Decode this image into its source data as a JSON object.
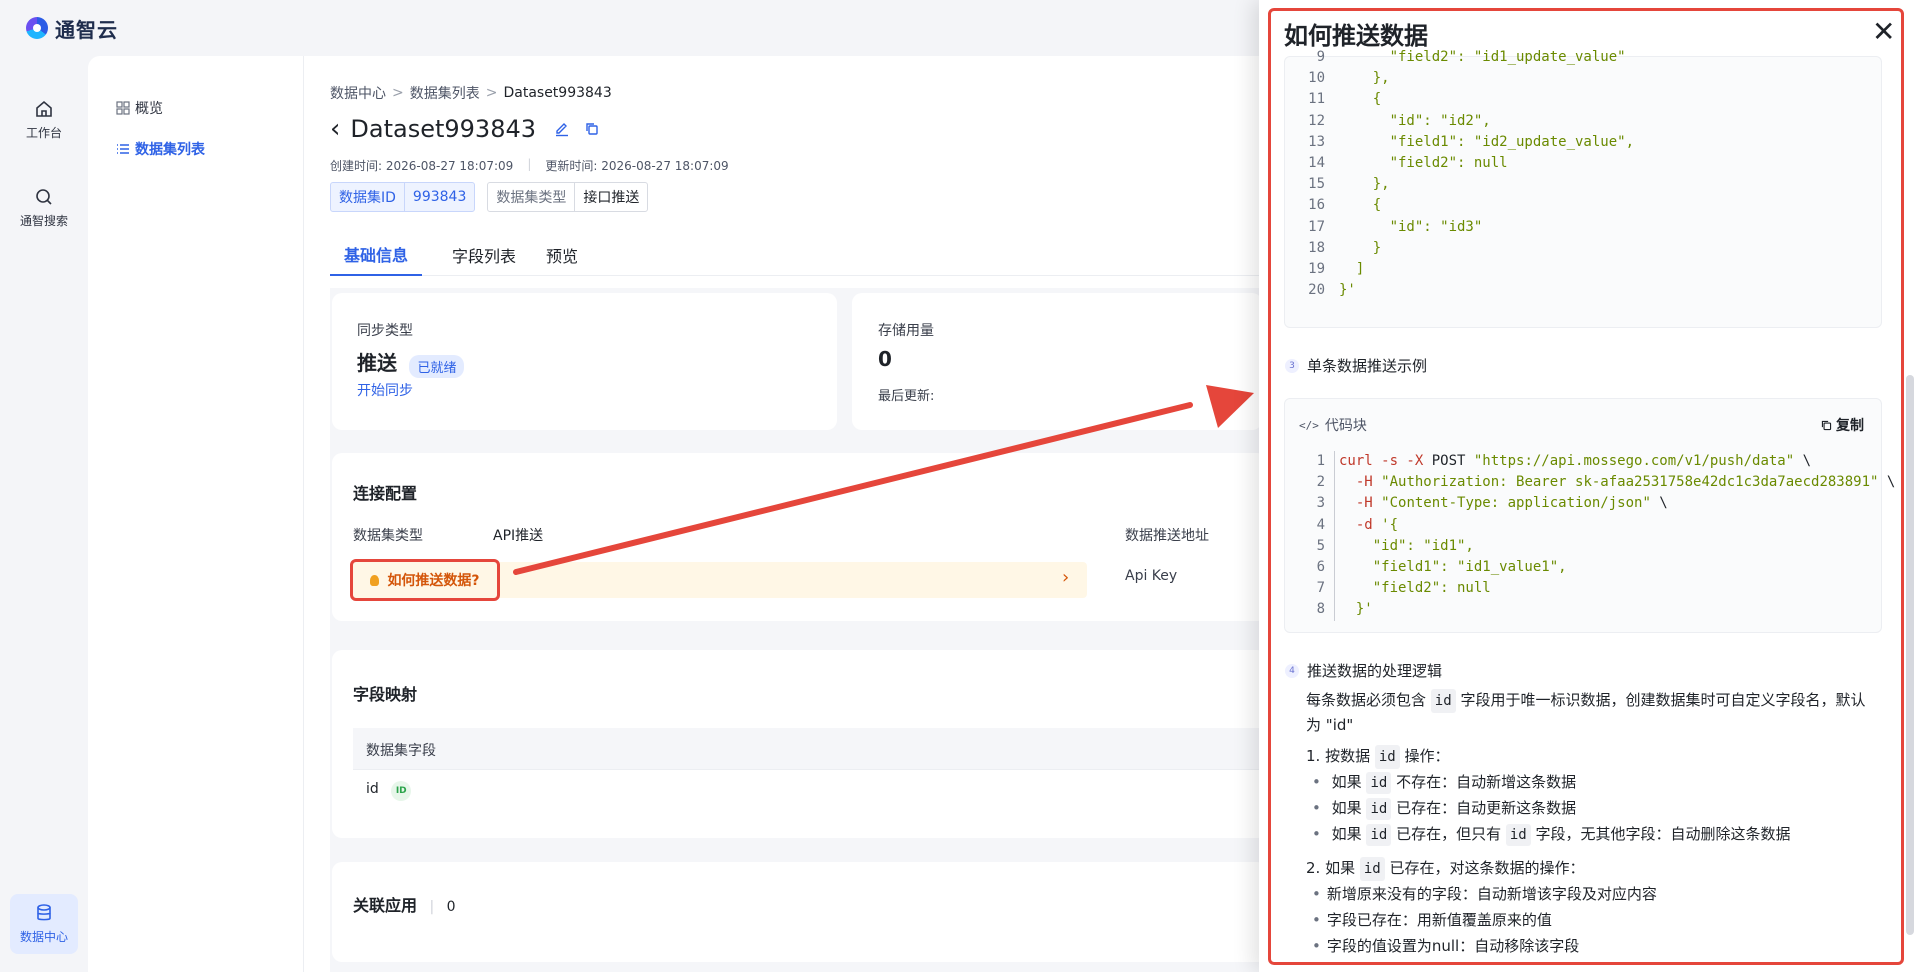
{
  "brand": {
    "name": "通智云"
  },
  "rail": [
    {
      "label": "工作台",
      "icon": "home-icon"
    },
    {
      "label": "通智搜索",
      "icon": "search-icon"
    },
    {
      "label": "数据中心",
      "icon": "database-icon"
    }
  ],
  "subnav": [
    {
      "label": "概览",
      "icon": "grid-icon"
    },
    {
      "label": "数据集列表",
      "icon": "list-icon"
    }
  ],
  "breadcrumb": [
    "数据中心",
    "数据集列表",
    "Dataset993843"
  ],
  "dataset": {
    "title": "Dataset993843",
    "created": "创建时间: 2026-08-27 18:07:09",
    "updated": "更新时间: 2026-08-27 18:07:09",
    "id_key": "数据集ID",
    "id_val": "993843",
    "type_key": "数据集类型",
    "type_val": "接口推送"
  },
  "tabs": [
    "基础信息",
    "字段列表",
    "预览"
  ],
  "sync": {
    "label": "同步类型",
    "value": "推送",
    "badge": "已就绪",
    "action": "开始同步"
  },
  "storage": {
    "label": "存储用量",
    "value": "0",
    "updated": "最后更新:"
  },
  "connection": {
    "title": "连接配置",
    "type_label": "数据集类型",
    "type_value": "API推送",
    "tip": "如何推送数据?",
    "push_addr_label": "数据推送地址",
    "api_key_label": "Api Key"
  },
  "fields": {
    "title": "字段映射",
    "col": "数据集字段",
    "row_name": "id",
    "row_badge": "ID"
  },
  "apps": {
    "title": "关联应用",
    "count": "0"
  },
  "drawer": {
    "title": "如何推送数据",
    "close": "✕",
    "top_code": [
      {
        "n": "9",
        "t": "      \"field2\": \"id1_update_value\""
      },
      {
        "n": "10",
        "t": "    },"
      },
      {
        "n": "11",
        "t": "    {"
      },
      {
        "n": "12",
        "t": "      \"id\": \"id2\","
      },
      {
        "n": "13",
        "t": "      \"field1\": \"id2_update_value\","
      },
      {
        "n": "14",
        "t": "      \"field2\": null"
      },
      {
        "n": "15",
        "t": "    },"
      },
      {
        "n": "16",
        "t": "    {"
      },
      {
        "n": "17",
        "t": "      \"id\": \"id3\""
      },
      {
        "n": "18",
        "t": "    }"
      },
      {
        "n": "19",
        "t": "  ]"
      },
      {
        "n": "20",
        "t": "}'"
      }
    ],
    "step3": {
      "num": "3",
      "title": "单条数据推送示例"
    },
    "code_label": "代码块",
    "copy": "复制",
    "curl_lines": [
      {
        "n": "1",
        "a": "curl -s -X ",
        "b": "POST ",
        "c": "\"https://api.mossego.com/v1/push/data\"",
        "d": " \\"
      },
      {
        "n": "2",
        "a": "  -H ",
        "b": "",
        "c": "\"Authorization: Bearer sk-afaa2531758e42dc1c3da7aecd283891\"",
        "d": " \\"
      },
      {
        "n": "3",
        "a": "  -H ",
        "b": "",
        "c": "\"Content-Type: application/json\"",
        "d": " \\"
      },
      {
        "n": "4",
        "a": "  -d ",
        "b": "",
        "c": "'{",
        "d": ""
      },
      {
        "n": "5",
        "a": "",
        "b": "",
        "c": "    \"id\": \"id1\",",
        "d": ""
      },
      {
        "n": "6",
        "a": "",
        "b": "",
        "c": "    \"field1\": \"id1_value1\",",
        "d": ""
      },
      {
        "n": "7",
        "a": "",
        "b": "",
        "c": "    \"field2\": null",
        "d": ""
      },
      {
        "n": "8",
        "a": "",
        "b": "",
        "c": "  }'",
        "d": ""
      }
    ],
    "step4": {
      "num": "4",
      "title": "推送数据的处理逻辑"
    },
    "desc_a": "每条数据必须包含",
    "desc_code": "id",
    "desc_b": "字段用于唯一标识数据，创建数据集时可自定义字段名，默认为",
    "desc_c": "\"id\"",
    "rule1": {
      "a": "1. 按数据",
      "code": "id",
      "b": "操作："
    },
    "rule1_items": [
      {
        "a": "如果",
        "code": "id",
        "b": "不存在：自动新增这条数据"
      },
      {
        "a": "如果",
        "code": "id",
        "b": "已存在：自动更新这条数据"
      },
      {
        "a": "如果",
        "code": "id",
        "b": "已存在，但只有",
        "code2": "id",
        "c": "字段，无其他字段：自动删除这条数据"
      }
    ],
    "rule2": {
      "a": "2. 如果",
      "code": "id",
      "b": "已存在，对这条数据的操作："
    },
    "rule2_items": [
      "新增原来没有的字段：自动新增该字段及对应内容",
      "字段已存在：用新值覆盖原来的值",
      "字段的值设置为null：自动移除该字段"
    ]
  }
}
